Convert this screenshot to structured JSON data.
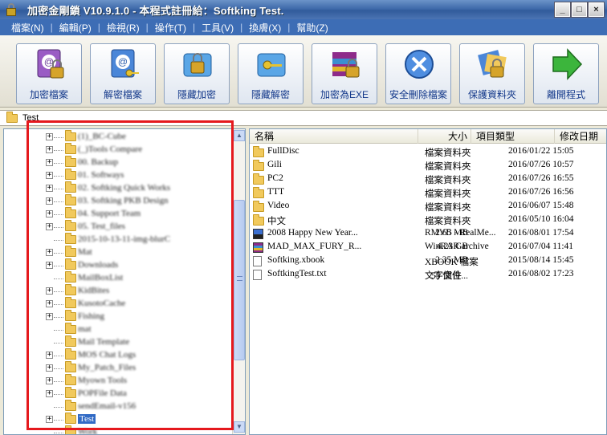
{
  "window": {
    "title": "加密金剛鎖 V10.9.1.0 - 本程式註冊給：Softking Test."
  },
  "menu": [
    "檔案(N)",
    "編輯(P)",
    "檢視(R)",
    "操作(T)",
    "工具(V)",
    "換膚(X)",
    "幫助(Z)"
  ],
  "toolbar": [
    {
      "label": "加密檔案",
      "icon": "encrypt-file-icon"
    },
    {
      "label": "解密檔案",
      "icon": "decrypt-file-icon"
    },
    {
      "label": "隱藏加密",
      "icon": "hide-encrypt-icon"
    },
    {
      "label": "隱藏解密",
      "icon": "hide-decrypt-icon"
    },
    {
      "label": "加密為EXE",
      "icon": "encrypt-exe-icon"
    },
    {
      "label": "安全刪除檔案",
      "icon": "secure-delete-icon"
    },
    {
      "label": "保護資料夾",
      "icon": "protect-folder-icon"
    },
    {
      "label": "離開程式",
      "icon": "exit-arrow-icon"
    }
  ],
  "address": {
    "path": "Test"
  },
  "tree": {
    "items": [
      {
        "label": "(1)_BC-Cube",
        "expandable": true
      },
      {
        "label": "(_)Tools Compare",
        "expandable": true
      },
      {
        "label": "00. Backup",
        "expandable": true
      },
      {
        "label": "01. Softways",
        "expandable": true
      },
      {
        "label": "02. Softking Quick Works",
        "expandable": true
      },
      {
        "label": "03. Softking PKB Design",
        "expandable": true
      },
      {
        "label": "04. Support Team",
        "expandable": true
      },
      {
        "label": "05. Test_files",
        "expandable": true
      },
      {
        "label": "2015-10-13-11-img-blurC",
        "expandable": false
      },
      {
        "label": "Mat",
        "expandable": true
      },
      {
        "label": "Downloads",
        "expandable": true
      },
      {
        "label": "MailBoxList",
        "expandable": false
      },
      {
        "label": "KidBites",
        "expandable": true
      },
      {
        "label": "KusotoCache",
        "expandable": true
      },
      {
        "label": "Fishing",
        "expandable": true
      },
      {
        "label": "mat",
        "expandable": false
      },
      {
        "label": "Mail Template",
        "expandable": false
      },
      {
        "label": "MOS Chat Logs",
        "expandable": true
      },
      {
        "label": "My_Patch_Files",
        "expandable": true
      },
      {
        "label": "Myown Tools",
        "expandable": true
      },
      {
        "label": "POPFile Data",
        "expandable": true
      },
      {
        "label": "sendEmail-v156",
        "expandable": false
      },
      {
        "label": "Test",
        "expandable": true,
        "selected": true
      },
      {
        "label": "Work",
        "expandable": false
      }
    ]
  },
  "files": {
    "columns": {
      "name": "名稱",
      "size": "大小",
      "type": "項目類型",
      "modified": "修改日期"
    },
    "rows": [
      {
        "name": "FullDisc",
        "size": "",
        "type": "檔案資料夾",
        "modified": "2016/01/22 15:05",
        "icon": "folder"
      },
      {
        "name": "Gili",
        "size": "",
        "type": "檔案資料夾",
        "modified": "2016/07/26 10:57",
        "icon": "folder"
      },
      {
        "name": "PC2",
        "size": "",
        "type": "檔案資料夾",
        "modified": "2016/07/26 16:55",
        "icon": "folder"
      },
      {
        "name": "TTT",
        "size": "",
        "type": "檔案資料夾",
        "modified": "2016/07/26 16:56",
        "icon": "folder"
      },
      {
        "name": "Video",
        "size": "",
        "type": "檔案資料夾",
        "modified": "2016/06/07 15:48",
        "icon": "folder"
      },
      {
        "name": "中文",
        "size": "",
        "type": "檔案資料夾",
        "modified": "2016/05/10 16:04",
        "icon": "folder"
      },
      {
        "name": "2008 Happy New Year...",
        "size": "2.65 MB",
        "type": "RMVB - RealMe...",
        "modified": "2016/08/01 17:54",
        "icon": "rmvb"
      },
      {
        "name": "MAD_MAX_FURY_R...",
        "size": "4.23 GB",
        "type": "WinRAR archive",
        "modified": "2016/07/04 11:41",
        "icon": "rar"
      },
      {
        "name": "Softking.xbook",
        "size": "2.35 MB",
        "type": "XBOOK 檔案",
        "modified": "2015/08/14 15:45",
        "icon": "doc"
      },
      {
        "name": "SoftkingTest.txt",
        "size": "55 個位...",
        "type": "文字文件",
        "modified": "2016/08/02 17:23",
        "icon": "doc"
      }
    ]
  }
}
